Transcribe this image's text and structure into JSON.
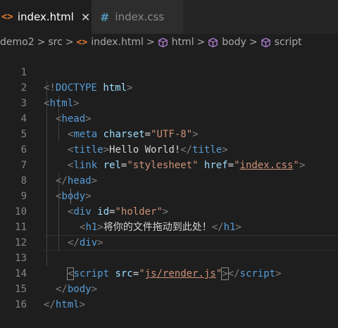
{
  "tabs": [
    {
      "label": "index.html",
      "icon": "html-file-icon",
      "active": true,
      "close_symbol": "✕"
    },
    {
      "label": "index.css",
      "icon": "css-file-icon",
      "active": false
    }
  ],
  "breadcrumb": {
    "items": [
      "demo2",
      "src",
      "index.html",
      "html",
      "body",
      "script"
    ],
    "separator": ">"
  },
  "editor": {
    "line_numbers": [
      "1",
      "2",
      "3",
      "4",
      "5",
      "6",
      "7",
      "8",
      "9",
      "10",
      "11",
      "12",
      "13",
      "14",
      "15",
      "16"
    ],
    "doctype": {
      "open": "<!",
      "keyword": "DOCTYPE",
      "name": "html",
      "close": ">"
    },
    "tags": {
      "html": "html",
      "head": "head",
      "meta": "meta",
      "title": "title",
      "link": "link",
      "body": "body",
      "div": "div",
      "h1": "h1",
      "script": "script"
    },
    "attributes": {
      "charset": "charset",
      "rel": "rel",
      "href": "href",
      "id": "id",
      "src": "src"
    },
    "values": {
      "charset": "\"UTF-8\"",
      "rel": "\"stylesheet\"",
      "href": "index.css",
      "id": "\"holder\"",
      "src": "js/render.js"
    },
    "text": {
      "title": "Hello World!",
      "h1": "将你的文件拖动到此处！"
    }
  },
  "colors": {
    "background": "#1e1e1e",
    "tag": "#569cd6",
    "attribute": "#9cdcfe",
    "string": "#ce9178",
    "punctuation": "#808080",
    "line_number": "#858585"
  }
}
